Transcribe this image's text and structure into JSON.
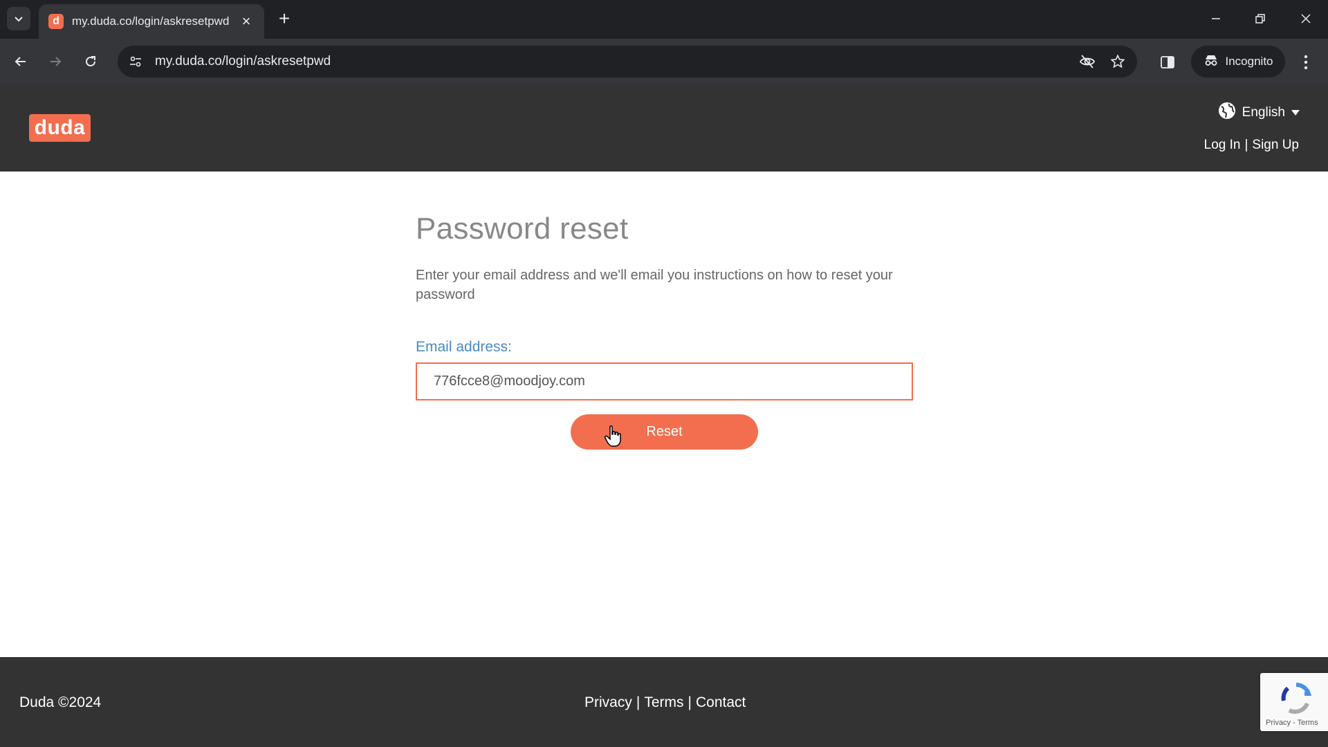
{
  "browser": {
    "tab_title": "my.duda.co/login/askresetpwd",
    "favicon_letter": "d",
    "url": "my.duda.co/login/askresetpwd",
    "incognito_label": "Incognito"
  },
  "site_header": {
    "logo_text": "duda",
    "language": "English",
    "login_label": "Log In",
    "separator": "|",
    "signup_label": "Sign Up"
  },
  "main": {
    "title": "Password reset",
    "description": "Enter your email address and we'll email you instructions on how to reset your password",
    "email_label": "Email address:",
    "email_value": "776fcce8@moodjoy.com",
    "reset_label": "Reset"
  },
  "footer": {
    "copyright": "Duda ©2024",
    "privacy": "Privacy",
    "terms": "Terms",
    "contact": "Contact",
    "separator": "|",
    "recaptcha_links": "Privacy - Terms"
  },
  "colors": {
    "brand": "#f26e4f",
    "header_bg": "#333333",
    "link_label": "#4a8ac2"
  },
  "icons": {
    "tab_search": "chevron-down-icon",
    "tab_close": "close-icon",
    "new_tab": "plus-icon",
    "back": "arrow-left-icon",
    "forward": "arrow-right-icon",
    "reload": "reload-icon",
    "site_info": "tune-icon",
    "eye_off": "eye-off-icon",
    "bookmark": "star-icon",
    "side_panel": "side-panel-icon",
    "incognito": "incognito-icon",
    "menu": "kebab-menu-icon",
    "globe": "globe-icon",
    "caret": "caret-down-icon",
    "recaptcha": "recaptcha-icon"
  }
}
